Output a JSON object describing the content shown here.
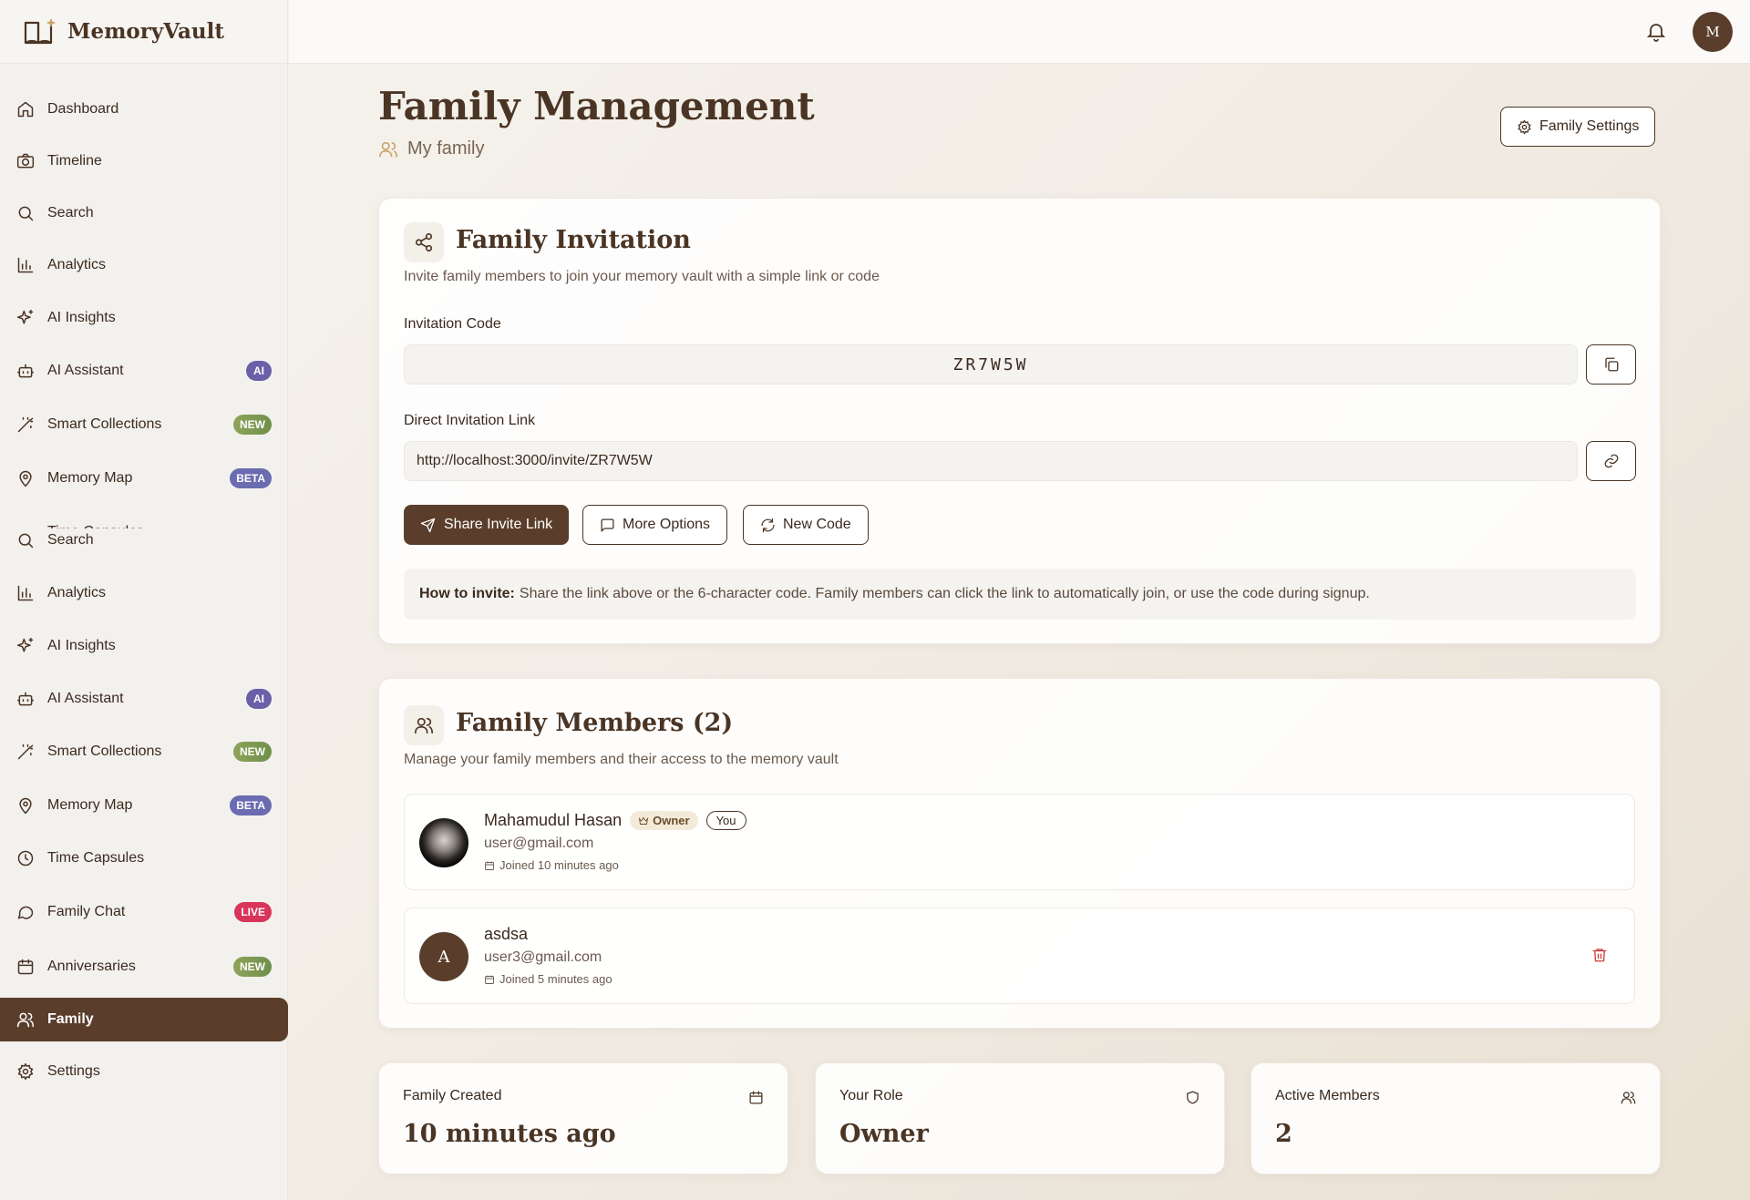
{
  "app": {
    "name": "MemoryVault",
    "logo_icon": "book-sparkle-icon"
  },
  "sidebar": {
    "items": [
      {
        "id": "dashboard",
        "label": "Dashboard",
        "icon": "home-icon"
      },
      {
        "id": "timeline",
        "label": "Timeline",
        "icon": "camera-icon"
      },
      {
        "id": "search",
        "label": "Search",
        "icon": "search-icon"
      },
      {
        "id": "analytics",
        "label": "Analytics",
        "icon": "bar-chart-icon"
      },
      {
        "id": "ai-insights",
        "label": "AI Insights",
        "icon": "sparkles-icon"
      },
      {
        "id": "ai-assistant",
        "label": "AI Assistant",
        "icon": "bot-icon",
        "badge": "AI"
      },
      {
        "id": "smart-collections",
        "label": "Smart Collections",
        "icon": "wand-icon",
        "badge": "NEW"
      },
      {
        "id": "memory-map",
        "label": "Memory Map",
        "icon": "map-pin-icon",
        "badge": "BETA"
      }
    ],
    "items_repeat": [
      {
        "id": "search",
        "label": "Search",
        "icon": "search-icon"
      },
      {
        "id": "analytics",
        "label": "Analytics",
        "icon": "bar-chart-icon"
      },
      {
        "id": "ai-insights",
        "label": "AI Insights",
        "icon": "sparkles-icon"
      },
      {
        "id": "ai-assistant",
        "label": "AI Assistant",
        "icon": "bot-icon",
        "badge": "AI"
      },
      {
        "id": "smart-collections",
        "label": "Smart Collections",
        "icon": "wand-icon",
        "badge": "NEW"
      },
      {
        "id": "memory-map",
        "label": "Memory Map",
        "icon": "map-pin-icon",
        "badge": "BETA"
      },
      {
        "id": "time-capsules",
        "label": "Time Capsules",
        "icon": "clock-icon"
      },
      {
        "id": "family-chat",
        "label": "Family Chat",
        "icon": "chat-icon",
        "badge": "LIVE"
      },
      {
        "id": "anniversaries",
        "label": "Anniversaries",
        "icon": "calendar-icon",
        "badge": "NEW"
      },
      {
        "id": "family",
        "label": "Family",
        "icon": "users-icon",
        "active": true
      },
      {
        "id": "settings",
        "label": "Settings",
        "icon": "gear-icon"
      }
    ]
  },
  "header": {
    "avatar_initial": "M",
    "bell_icon": "bell-icon"
  },
  "page": {
    "title": "Family Management",
    "subtitle": "My family",
    "settings_button": "Family Settings"
  },
  "invitation": {
    "title": "Family Invitation",
    "description": "Invite family members to join your memory vault with a simple link or code",
    "code_label": "Invitation Code",
    "code": "ZR7W5W",
    "link_label": "Direct Invitation Link",
    "link": "http://localhost:3000/invite/ZR7W5W",
    "share_button": "Share Invite Link",
    "more_button": "More Options",
    "new_code_button": "New Code",
    "note_bold": "How to invite:",
    "note_text": "Share the link above or the 6-character code. Family members can click the link to automatically join, or use the code during signup."
  },
  "members": {
    "title": "Family Members (2)",
    "description": "Manage your family members and their access to the memory vault",
    "list": [
      {
        "name": "Mahamudul Hasan",
        "email": "user@gmail.com",
        "joined": "Joined 10 minutes ago",
        "owner_tag": "Owner",
        "you_tag": "You"
      },
      {
        "name": "asdsa",
        "email": "user3@gmail.com",
        "joined": "Joined 5 minutes ago",
        "initial": "A"
      }
    ]
  },
  "stats": [
    {
      "label": "Family Created",
      "value": "10 minutes ago",
      "icon": "calendar-icon"
    },
    {
      "label": "Your Role",
      "value": "Owner",
      "icon": "shield-icon"
    },
    {
      "label": "Active Members",
      "value": "2",
      "icon": "users-icon"
    }
  ],
  "colors": {
    "primary": "#5a3e2b",
    "accent": "#c9a46a",
    "danger": "#d23b3b"
  }
}
